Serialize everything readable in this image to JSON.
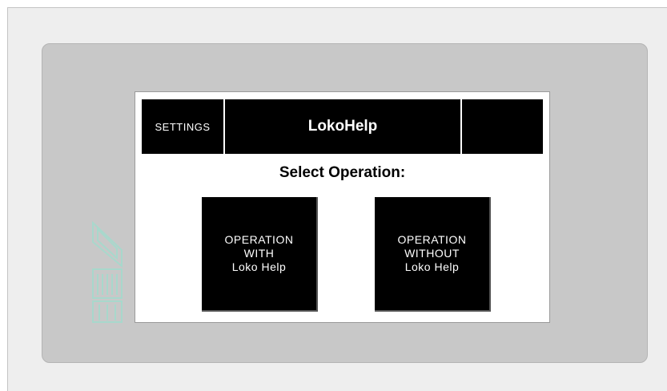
{
  "header": {
    "settings_label": "SETTINGS",
    "title": "LokoHelp"
  },
  "main": {
    "subtitle": "Select Operation:",
    "buttons": [
      {
        "label": "OPERATION\nWITH\nLoko Help"
      },
      {
        "label": "OPERATION\nWITHOUT\nLoko Help"
      }
    ]
  },
  "colors": {
    "bezel": "#c8c8c8",
    "logo": "#a8d8cc",
    "screen_bg": "#ffffff",
    "button_bg": "#000000",
    "button_text": "#ffffff"
  }
}
